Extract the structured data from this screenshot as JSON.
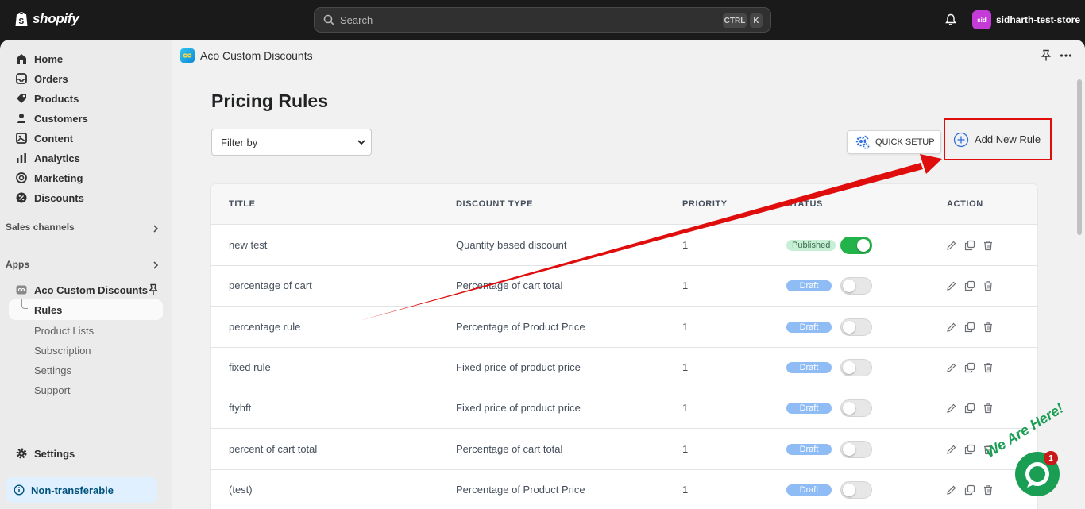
{
  "topbar": {
    "brand": "shopify",
    "search_placeholder": "Search",
    "kbd_ctrl": "CTRL",
    "kbd_k": "K",
    "store_avatar": "sid",
    "store_name": "sidharth-test-store"
  },
  "sidebar": {
    "items": [
      {
        "label": "Home",
        "icon": "home-icon"
      },
      {
        "label": "Orders",
        "icon": "orders-icon"
      },
      {
        "label": "Products",
        "icon": "tag-icon"
      },
      {
        "label": "Customers",
        "icon": "person-icon"
      },
      {
        "label": "Content",
        "icon": "content-icon"
      },
      {
        "label": "Analytics",
        "icon": "bar-chart-icon"
      },
      {
        "label": "Marketing",
        "icon": "target-icon"
      },
      {
        "label": "Discounts",
        "icon": "discount-icon"
      }
    ],
    "sales_channels": "Sales channels",
    "apps": "Apps",
    "app_name": "Aco Custom Discounts",
    "app_sub": {
      "selected": "Rules",
      "others": [
        "Product Lists",
        "Subscription",
        "Settings",
        "Support"
      ]
    },
    "settings": "Settings",
    "non_transferable": "Non-transferable"
  },
  "main": {
    "app_title": "Aco Custom Discounts",
    "page_title": "Pricing Rules",
    "filter_label": "Filter by",
    "quick_setup": "QUICK SETUP",
    "add_new_rule": "Add New Rule",
    "columns": [
      "TITLE",
      "DISCOUNT TYPE",
      "PRIORITY",
      "STATUS",
      "ACTION"
    ],
    "rows": [
      {
        "title": "new test",
        "type": "Quantity based discount",
        "priority": "1",
        "status": "Published",
        "enabled": true
      },
      {
        "title": "percentage of cart",
        "type": "Percentage of cart total",
        "priority": "1",
        "status": "Draft",
        "enabled": false
      },
      {
        "title": "percentage rule",
        "type": "Percentage of Product Price",
        "priority": "1",
        "status": "Draft",
        "enabled": false
      },
      {
        "title": "fixed rule",
        "type": "Fixed price of product price",
        "priority": "1",
        "status": "Draft",
        "enabled": false
      },
      {
        "title": "ftyhft",
        "type": "Fixed price of product price",
        "priority": "1",
        "status": "Draft",
        "enabled": false
      },
      {
        "title": "percent of cart total",
        "type": "Percentage of cart total",
        "priority": "1",
        "status": "Draft",
        "enabled": false
      },
      {
        "title": "(test)",
        "type": "Percentage of Product Price",
        "priority": "1",
        "status": "Draft",
        "enabled": false
      }
    ]
  },
  "chat": {
    "badge_count": "1",
    "tagline": "We Are Here!"
  },
  "colors": {
    "annotation": "#e00d0d",
    "toggle_on": "#22b34a",
    "draft_badge": "#8fbcf5",
    "published_badge": "#c6efd5"
  }
}
